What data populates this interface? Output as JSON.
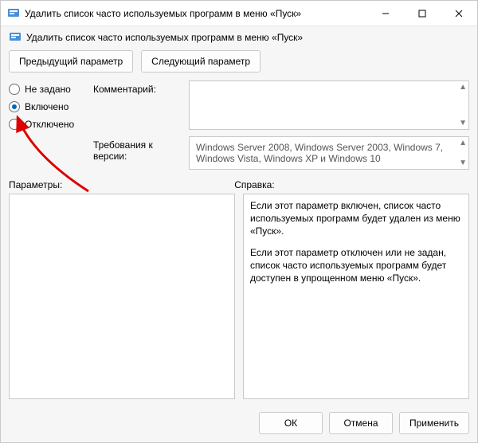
{
  "titlebar": {
    "title": "Удалить список часто используемых программ в меню «Пуск»"
  },
  "subtitle": "Удалить список часто используемых программ в меню «Пуск»",
  "nav": {
    "prev": "Предыдущий параметр",
    "next": "Следующий параметр"
  },
  "radios": {
    "not_configured": "Не задано",
    "enabled": "Включено",
    "disabled": "Отключено",
    "selected": "enabled"
  },
  "labels": {
    "comment": "Комментарий:",
    "requirements": "Требования к версии:",
    "parameters": "Параметры:",
    "help": "Справка:"
  },
  "requirements_text": "Windows Server 2008, Windows Server 2003, Windows 7, Windows Vista, Windows XP и Windows 10",
  "help": {
    "p1": "Если этот параметр включен, список часто используемых программ будет удален из меню «Пуск».",
    "p2": "Если этот параметр отключен или не задан, список часто используемых программ будет доступен в упрощенном меню «Пуск»."
  },
  "footer": {
    "ok": "ОК",
    "cancel": "Отмена",
    "apply": "Применить"
  },
  "icons": {
    "app": "policy-icon",
    "minimize": "minimize-icon",
    "maximize": "maximize-icon",
    "close": "close-icon"
  }
}
